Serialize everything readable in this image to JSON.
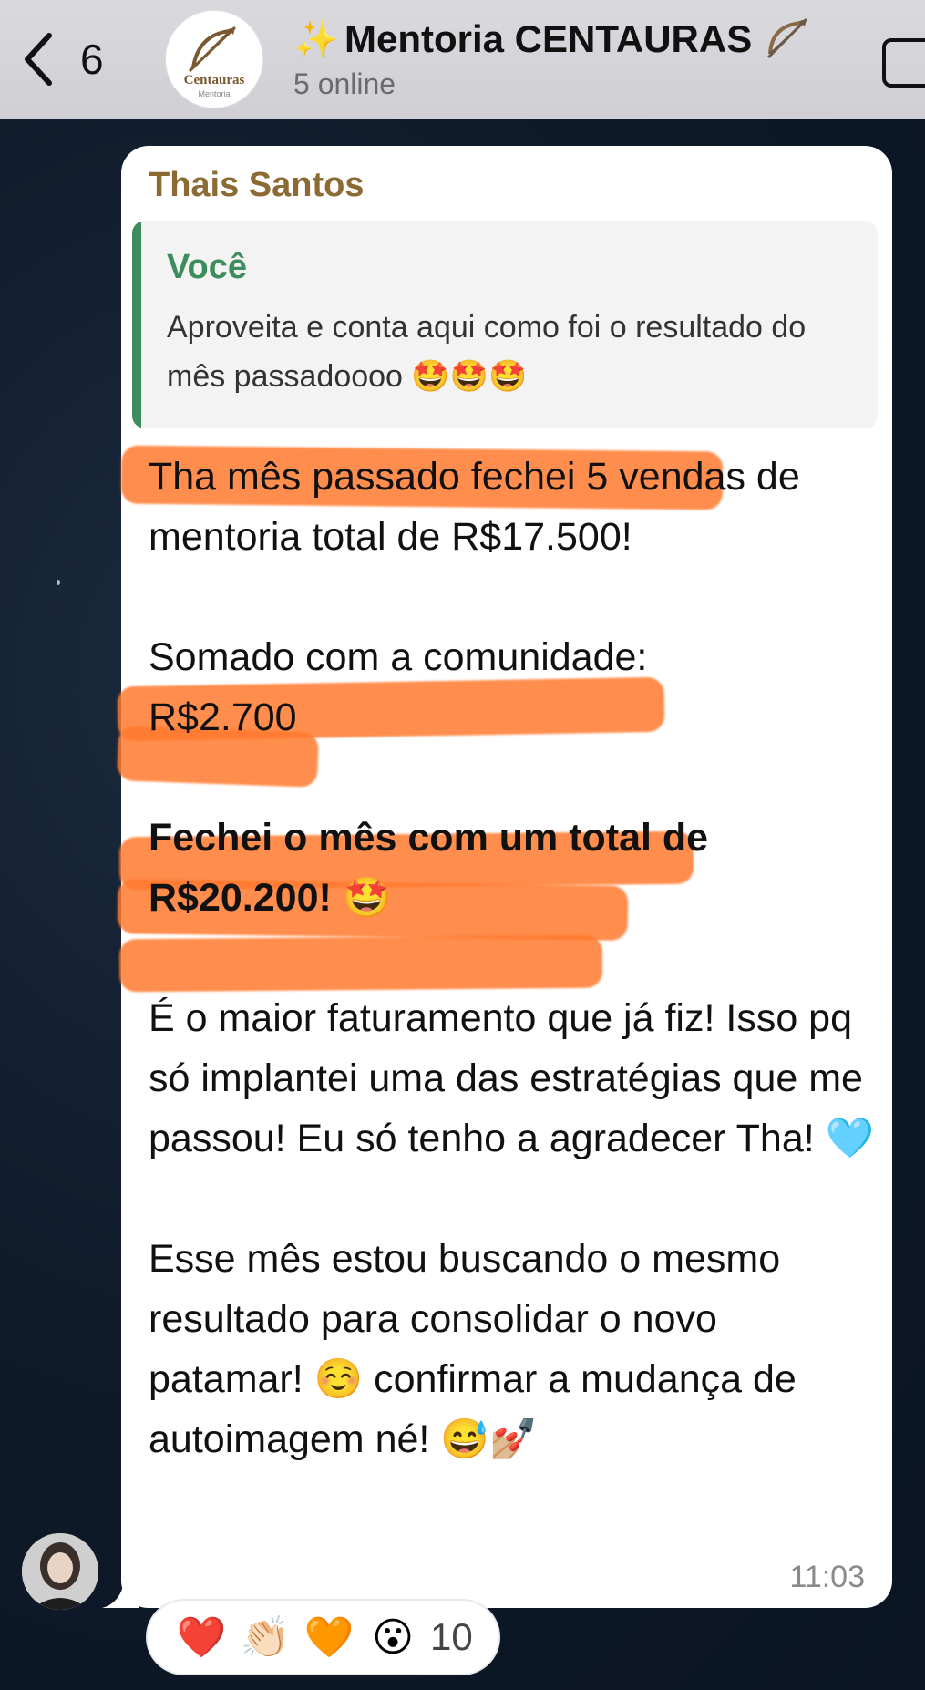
{
  "header": {
    "back_count": "6",
    "title_prefix_icon": "✨",
    "title": "Mentoria CENTAURAS",
    "status": "5 online",
    "group_avatar_text": "Centauras",
    "group_avatar_subtext": "Mentoria"
  },
  "message": {
    "sender": "Thais Santos",
    "reply": {
      "author": "Você",
      "text": "Aproveita e conta aqui como foi o resultado do mês passadoooo 🤩🤩🤩"
    },
    "paragraphs": [
      "Tha mês passado fechei 5 vendas de mentoria total de R$17.500!",
      "Somado com a comunidade:\nR$2.700",
      "Fechei o mês com um total de R$20.200! 🤩",
      "É o maior faturamento que já fiz! Isso pq só implantei uma das estratégias que me passou! Eu só tenho a agradecer Tha! 🩵",
      "Esse mês estou buscando o mesmo resultado para consolidar o novo patamar! ☺️ confirmar a mudança de autoimagem né! 😅💅🏼"
    ],
    "time": "11:03"
  },
  "reactions": {
    "emojis": [
      "❤️",
      "👏🏻",
      "🧡",
      "😮"
    ],
    "count": "10"
  },
  "colors": {
    "highlight": "#ff7a2e",
    "sender_name": "#8b6a33",
    "reply_accent": "#3c8c5d"
  }
}
